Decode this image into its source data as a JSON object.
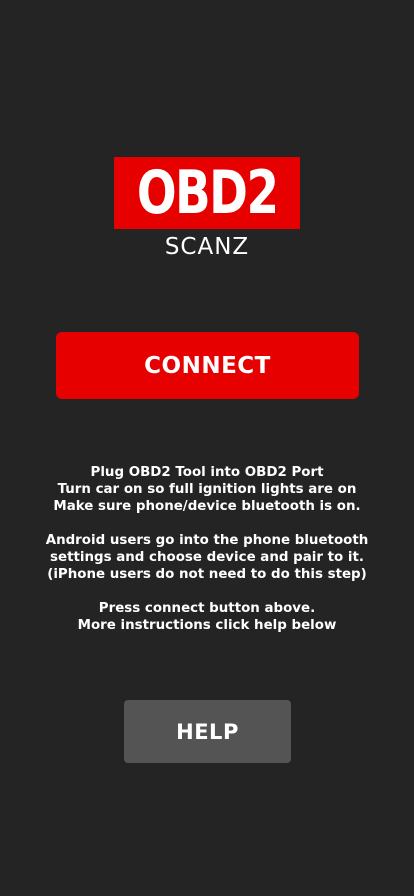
{
  "logo": {
    "title": "OBD2",
    "subtitle": "SCANZ"
  },
  "connect_button": {
    "label": "CONNECT"
  },
  "instructions": {
    "paragraph1": [
      "Plug OBD2 Tool into OBD2 Port",
      "Turn car on so full ignition lights are on",
      "Make sure phone/device bluetooth is on."
    ],
    "paragraph2": [
      "Android users go into the phone bluetooth",
      "settings and choose device and pair to it.",
      "(iPhone users do not need to do this step)"
    ],
    "paragraph3": [
      "Press connect button above.",
      "More instructions click help below"
    ]
  },
  "help_button": {
    "label": "HELP"
  },
  "colors": {
    "background": "#242424",
    "accent_red": "#e60000",
    "help_gray": "#545454",
    "text": "#ffffff"
  }
}
